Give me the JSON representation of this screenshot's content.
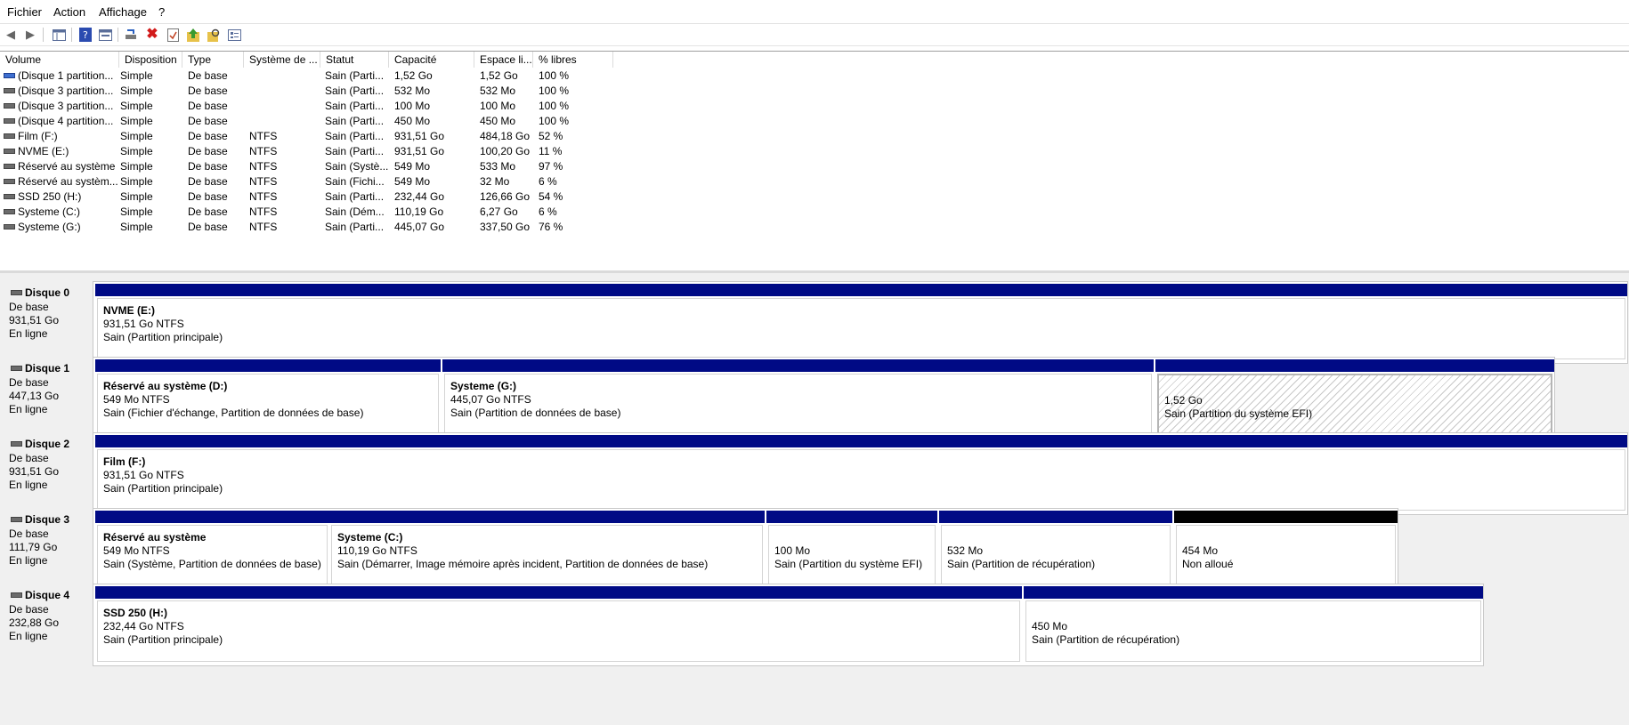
{
  "menu": [
    "Fichier",
    "Action",
    "Affichage",
    "?"
  ],
  "toolbar_icons": [
    "back-icon",
    "forward-icon",
    "console-tree-icon",
    "help-icon",
    "properties-panel-icon",
    "connect-icon",
    "delete-icon",
    "check-icon",
    "up-icon",
    "search-icon",
    "settings-icon"
  ],
  "columns": [
    "Volume",
    "Disposition",
    "Type",
    "Système de ...",
    "Statut",
    "Capacité",
    "Espace li...",
    "% libres"
  ],
  "volumes": [
    {
      "name": "(Disque 1 partition...",
      "layout": "Simple",
      "type": "De base",
      "fs": "",
      "status": "Sain (Parti...",
      "capacity": "1,52 Go",
      "free": "1,52 Go",
      "pct": "100 %"
    },
    {
      "name": "(Disque 3 partition...",
      "layout": "Simple",
      "type": "De base",
      "fs": "",
      "status": "Sain (Parti...",
      "capacity": "532 Mo",
      "free": "532 Mo",
      "pct": "100 %"
    },
    {
      "name": "(Disque 3 partition...",
      "layout": "Simple",
      "type": "De base",
      "fs": "",
      "status": "Sain (Parti...",
      "capacity": "100 Mo",
      "free": "100 Mo",
      "pct": "100 %"
    },
    {
      "name": "(Disque 4 partition...",
      "layout": "Simple",
      "type": "De base",
      "fs": "",
      "status": "Sain (Parti...",
      "capacity": "450 Mo",
      "free": "450 Mo",
      "pct": "100 %"
    },
    {
      "name": "Film (F:)",
      "layout": "Simple",
      "type": "De base",
      "fs": "NTFS",
      "status": "Sain (Parti...",
      "capacity": "931,51 Go",
      "free": "484,18 Go",
      "pct": "52 %"
    },
    {
      "name": "NVME (E:)",
      "layout": "Simple",
      "type": "De base",
      "fs": "NTFS",
      "status": "Sain (Parti...",
      "capacity": "931,51 Go",
      "free": "100,20 Go",
      "pct": "11 %"
    },
    {
      "name": "Réservé au système",
      "layout": "Simple",
      "type": "De base",
      "fs": "NTFS",
      "status": "Sain (Systè...",
      "capacity": "549 Mo",
      "free": "533 Mo",
      "pct": "97 %"
    },
    {
      "name": "Réservé au systèm...",
      "layout": "Simple",
      "type": "De base",
      "fs": "NTFS",
      "status": "Sain (Fichi...",
      "capacity": "549 Mo",
      "free": "32 Mo",
      "pct": "6 %"
    },
    {
      "name": "SSD 250 (H:)",
      "layout": "Simple",
      "type": "De base",
      "fs": "NTFS",
      "status": "Sain (Parti...",
      "capacity": "232,44 Go",
      "free": "126,66 Go",
      "pct": "54 %"
    },
    {
      "name": "Systeme (C:)",
      "layout": "Simple",
      "type": "De base",
      "fs": "NTFS",
      "status": "Sain (Dém...",
      "capacity": "110,19 Go",
      "free": "6,27 Go",
      "pct": "6 %"
    },
    {
      "name": "Systeme (G:)",
      "layout": "Simple",
      "type": "De base",
      "fs": "NTFS",
      "status": "Sain (Parti...",
      "capacity": "445,07 Go",
      "free": "337,50 Go",
      "pct": "76 %"
    }
  ],
  "disks": [
    {
      "name": "Disque 0",
      "type": "De base",
      "size": "931,51 Go",
      "state": "En ligne",
      "partitions": [
        {
          "title": "NVME  (E:)",
          "line2": "931,51 Go NTFS",
          "line3": "Sain (Partition principale)"
        }
      ]
    },
    {
      "name": "Disque 1",
      "type": "De base",
      "size": "447,13 Go",
      "state": "En ligne",
      "partitions": [
        {
          "title": "Réservé au système  (D:)",
          "line2": "549 Mo NTFS",
          "line3": "Sain (Fichier d'échange, Partition de données de base)"
        },
        {
          "title": "Systeme  (G:)",
          "line2": "445,07 Go NTFS",
          "line3": "Sain (Partition de données de base)"
        },
        {
          "title": "",
          "line2": "1,52 Go",
          "line3": "Sain (Partition du système EFI)"
        }
      ]
    },
    {
      "name": "Disque 2",
      "type": "De base",
      "size": "931,51 Go",
      "state": "En ligne",
      "partitions": [
        {
          "title": "Film  (F:)",
          "line2": "931,51 Go NTFS",
          "line3": "Sain (Partition principale)"
        }
      ]
    },
    {
      "name": "Disque 3",
      "type": "De base",
      "size": "111,79 Go",
      "state": "En ligne",
      "partitions": [
        {
          "title": "Réservé au système",
          "line2": "549 Mo NTFS",
          "line3": "Sain (Système, Partition de données de base)"
        },
        {
          "title": "Systeme  (C:)",
          "line2": "110,19 Go NTFS",
          "line3": "Sain (Démarrer, Image mémoire après incident, Partition de données de base)"
        },
        {
          "title": "",
          "line2": "100 Mo",
          "line3": "Sain (Partition du système EFI)"
        },
        {
          "title": "",
          "line2": "532 Mo",
          "line3": "Sain (Partition de récupération)"
        },
        {
          "title": "",
          "line2": "454 Mo",
          "line3": "Non alloué"
        }
      ]
    },
    {
      "name": "Disque 4",
      "type": "De base",
      "size": "232,88 Go",
      "state": "En ligne",
      "partitions": [
        {
          "title": "SSD 250  (H:)",
          "line2": "232,44 Go NTFS",
          "line3": "Sain (Partition principale)"
        },
        {
          "title": "",
          "line2": "450 Mo",
          "line3": "Sain (Partition de récupération)"
        }
      ]
    }
  ],
  "colors": {
    "primary_bar": "#000a85",
    "unallocated_bar": "#000000"
  }
}
